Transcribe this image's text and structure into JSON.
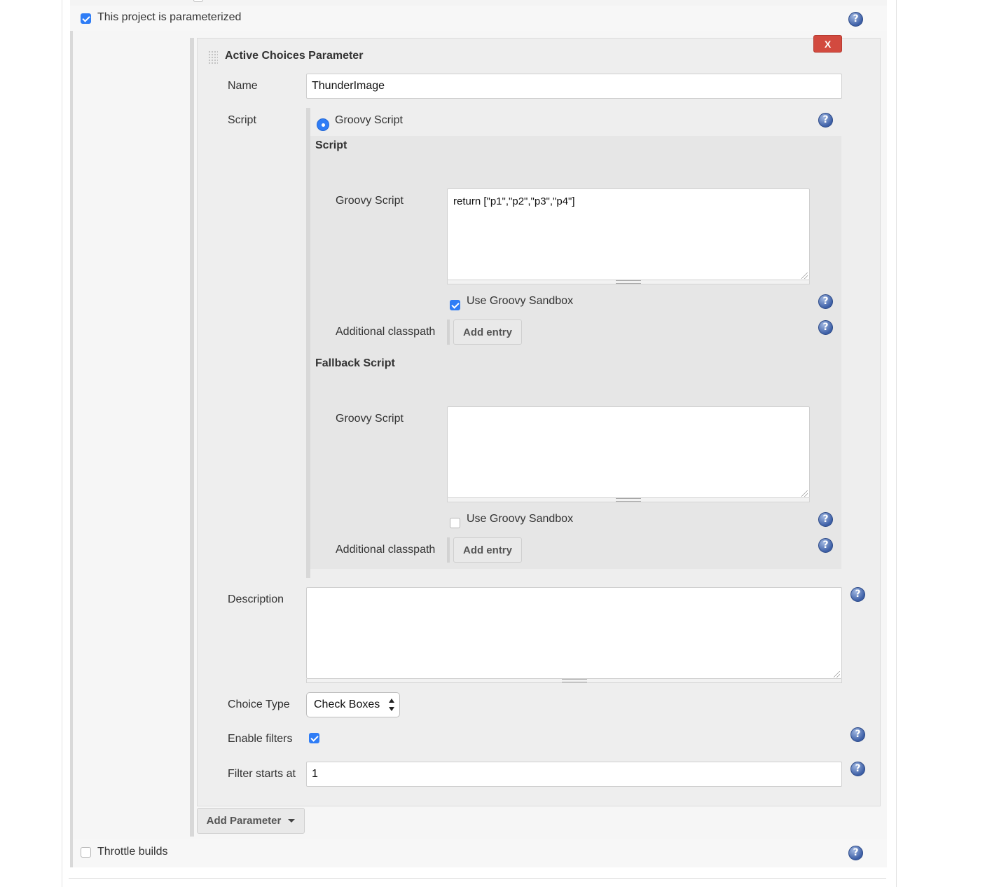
{
  "parameterized": {
    "label": "This project is parameterized",
    "checked": true
  },
  "parameter": {
    "title": "Active Choices Parameter",
    "delete_label": "X",
    "name_label": "Name",
    "name_value": "ThunderImage",
    "script_label": "Script",
    "script_type_option": "Groovy Script",
    "script_section": {
      "heading": "Script",
      "groovy_label": "Groovy Script",
      "groovy_value": "return [\"p1\",\"p2\",\"p3\",\"p4\"]",
      "sandbox_label": "Use Groovy Sandbox",
      "sandbox_checked": true,
      "classpath_label": "Additional classpath",
      "add_entry_label": "Add entry"
    },
    "fallback_section": {
      "heading": "Fallback Script",
      "groovy_label": "Groovy Script",
      "groovy_value": "",
      "sandbox_label": "Use Groovy Sandbox",
      "sandbox_checked": false,
      "classpath_label": "Additional classpath",
      "add_entry_label": "Add entry"
    },
    "description_label": "Description",
    "description_value": "",
    "choice_type_label": "Choice Type",
    "choice_type_value": "Check Boxes",
    "enable_filters_label": "Enable filters",
    "enable_filters_checked": true,
    "filter_starts_label": "Filter starts at",
    "filter_starts_value": "1"
  },
  "add_parameter_label": "Add Parameter",
  "throttle": {
    "label": "Throttle builds",
    "checked": false
  },
  "help_glyph": "?",
  "icons": {
    "help": "help-icon",
    "drag": "drag-handle-icon",
    "resize": "resize-grip-icon",
    "dropdown": "caret-down-icon",
    "select": "select-arrows-icon"
  },
  "colors": {
    "accent": "#2f7df6",
    "delete": "#d24a3f",
    "panel": "#eeeeee",
    "help": "#3d5fa6"
  }
}
